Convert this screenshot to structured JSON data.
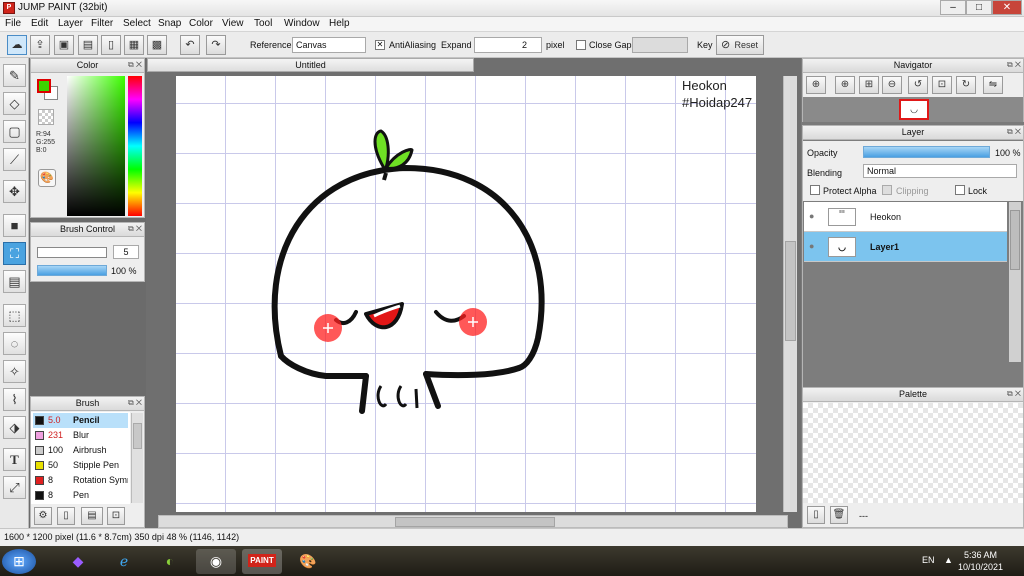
{
  "window": {
    "title": "JUMP PAINT (32bit)",
    "app_icon": "P",
    "min": "–",
    "max": "□",
    "close": "✕"
  },
  "menu": [
    "File",
    "Edit",
    "Layer",
    "Filter",
    "Select",
    "Snap",
    "Color",
    "View",
    "Tool",
    "Window",
    "Help"
  ],
  "toolbar": {
    "reference_label": "Reference",
    "reference_value": "Canvas",
    "antialiasing_label": "AntiAliasing",
    "expand_label": "Expand",
    "expand_value": "2",
    "expand_unit": "pixel",
    "close_gaps_label": "Close Gaps",
    "key_label": "Key",
    "reset_label": "Reset"
  },
  "color_panel": {
    "title": "Color",
    "r": "R:94",
    "g": "G:255",
    "b": "B:0",
    "fg": "#3cd400",
    "bg": "#ffffff"
  },
  "brush_control": {
    "title": "Brush Control",
    "size": "5",
    "opacity": "100 %"
  },
  "brush_panel": {
    "title": "Brush",
    "items": [
      {
        "size": "5.0",
        "name": "Pencil",
        "color": "#111111",
        "selected": true
      },
      {
        "size": "231",
        "name": "Blur",
        "color": "#f0a0e0"
      },
      {
        "size": "100",
        "name": "Airbrush",
        "color": "#cccccc"
      },
      {
        "size": "50",
        "name": "Stipple Pen",
        "color": "#e8e000"
      },
      {
        "size": "8",
        "name": "Rotation Symm",
        "color": "#e02020"
      },
      {
        "size": "8",
        "name": "Pen",
        "color": "#111111"
      }
    ]
  },
  "document": {
    "tab": "Untitled",
    "text_line1": "Heokon",
    "text_line2": "#Hoidap247"
  },
  "navigator": {
    "title": "Navigator"
  },
  "layer_panel": {
    "title": "Layer",
    "opacity_label": "Opacity",
    "opacity_value": "100 %",
    "opacity": 1.0,
    "blending_label": "Blending",
    "blending_value": "Normal",
    "protect_alpha": "Protect Alpha",
    "clipping": "Clipping",
    "lock": "Lock",
    "layers": [
      {
        "name": "Heokon",
        "selected": false
      },
      {
        "name": "Layer1",
        "selected": true
      }
    ]
  },
  "palette": {
    "title": "Palette",
    "footer": "---"
  },
  "status": {
    "text": "1600 * 1200 pixel  (11.6 * 8.7cm)  350 dpi  48 %  (1146, 1142)"
  },
  "taskbar": {
    "lang": "EN",
    "time": "5:36 AM",
    "date": "10/10/2021"
  }
}
